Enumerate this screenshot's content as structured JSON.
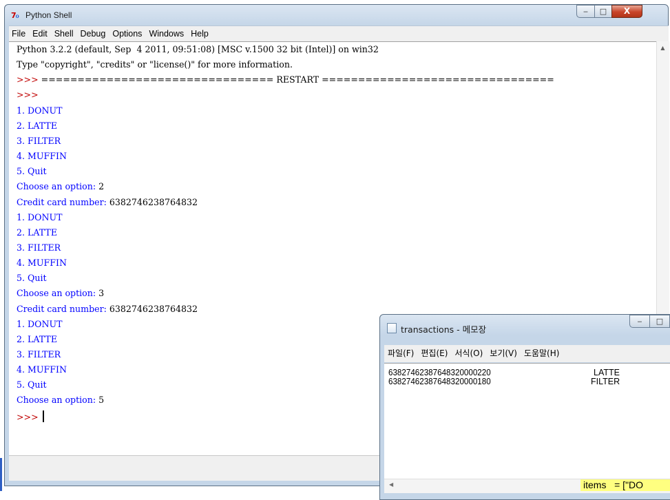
{
  "shell": {
    "title": "Python Shell",
    "controls": {
      "minimize": "‒",
      "maximize": "□",
      "close": "X"
    },
    "menu": [
      "File",
      "Edit",
      "Shell",
      "Debug",
      "Options",
      "Windows",
      "Help"
    ],
    "lines": [
      {
        "text": "Python 3.2.2 (default, Sep  4 2011, 09:51:08) [MSC v.1500 32 bit (Intel)] on win32",
        "kind": "hdr"
      },
      {
        "text": "Type \"copyright\", \"credits\" or \"license()\" for more information.",
        "kind": "hdr"
      },
      {
        "text": ">>> ================================ RESTART ================================",
        "kind": "restart"
      },
      {
        "text": ">>>",
        "kind": "prompt"
      },
      {
        "text": "1. DONUT",
        "kind": "out"
      },
      {
        "text": "2. LATTE",
        "kind": "out"
      },
      {
        "text": "3. FILTER",
        "kind": "out"
      },
      {
        "text": "4. MUFFIN",
        "kind": "out"
      },
      {
        "text": "5. Quit",
        "kind": "out"
      },
      {
        "text": "Choose an option: ",
        "input": "2",
        "kind": "ask"
      },
      {
        "text": "Credit card number: ",
        "input": "6382746238764832",
        "kind": "ask"
      },
      {
        "text": "1. DONUT",
        "kind": "out"
      },
      {
        "text": "2. LATTE",
        "kind": "out"
      },
      {
        "text": "3. FILTER",
        "kind": "out"
      },
      {
        "text": "4. MUFFIN",
        "kind": "out"
      },
      {
        "text": "5. Quit",
        "kind": "out"
      },
      {
        "text": "Choose an option: ",
        "input": "3",
        "kind": "ask"
      },
      {
        "text": "Credit card number: ",
        "input": "6382746238764832",
        "kind": "ask"
      },
      {
        "text": "1. DONUT",
        "kind": "out"
      },
      {
        "text": "2. LATTE",
        "kind": "out"
      },
      {
        "text": "3. FILTER",
        "kind": "out"
      },
      {
        "text": "4. MUFFIN",
        "kind": "out"
      },
      {
        "text": "5. Quit",
        "kind": "out"
      },
      {
        "text": "Choose an option: ",
        "input": "5",
        "kind": "ask"
      },
      {
        "text": ">>> ",
        "kind": "cursor"
      }
    ]
  },
  "notepad": {
    "title": "transactions - 메모장",
    "controls": {
      "minimize": "‒",
      "maximize": "□"
    },
    "menu": [
      "파일(F)",
      "편집(E)",
      "서식(O)",
      "보기(V)",
      "도움말(H)"
    ],
    "rows": [
      {
        "code": "63827462387648320000220",
        "item": "LATTE"
      },
      {
        "code": "63827462387648320000180",
        "item": "FILTER"
      }
    ]
  },
  "background_editor": {
    "snippet": "items   = [\"DO"
  }
}
